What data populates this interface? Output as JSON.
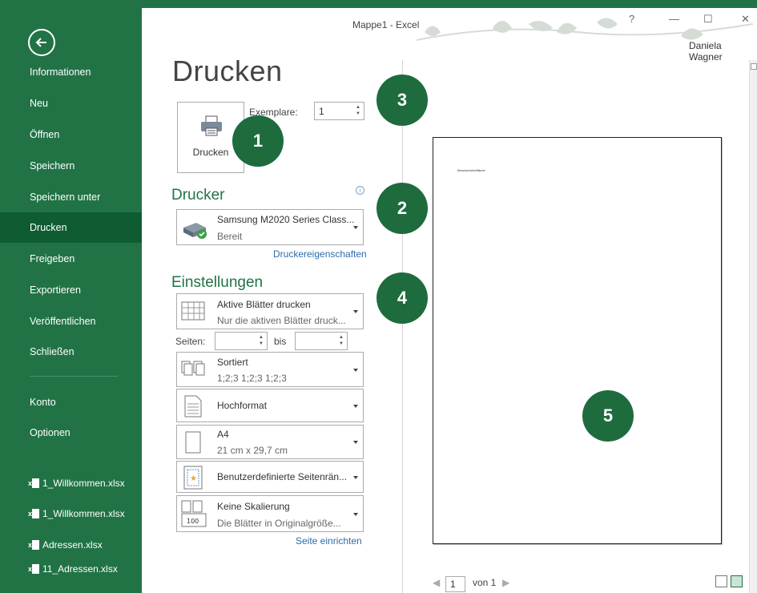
{
  "window": {
    "title": "Mappe1 - Excel",
    "help": "?",
    "minimize": "—",
    "maximize": "☐",
    "close": "✕",
    "user": "Daniela Wagner"
  },
  "sidebar": {
    "back_icon": "back-arrow-icon",
    "items": [
      {
        "label": "Informationen"
      },
      {
        "label": "Neu"
      },
      {
        "label": "Öffnen"
      },
      {
        "label": "Speichern"
      },
      {
        "label": "Speichern unter"
      },
      {
        "label": "Drucken",
        "active": true
      },
      {
        "label": "Freigeben"
      },
      {
        "label": "Exportieren"
      },
      {
        "label": "Veröffentlichen"
      },
      {
        "label": "Schließen"
      },
      {
        "label": "Konto"
      },
      {
        "label": "Optionen"
      }
    ],
    "recent": [
      {
        "label": "1_Willkommen.xlsx"
      },
      {
        "label": "1_Willkommen.xlsx"
      },
      {
        "label": "Adressen.xlsx"
      },
      {
        "label": "11_Adressen.xlsx"
      }
    ]
  },
  "print": {
    "heading": "Drucken",
    "print_button": "Drucken",
    "copies_label": "Exemplare:",
    "copies_value": "1",
    "printer_heading": "Drucker",
    "printer_name": "Samsung M2020 Series Class...",
    "printer_status": "Bereit",
    "printer_properties_link": "Druckereigenschaften",
    "settings_heading": "Einstellungen",
    "what": {
      "title": "Aktive Blätter drucken",
      "sub": "Nur die aktiven Blätter druck..."
    },
    "pages_label": "Seiten:",
    "to_label": "bis",
    "collate": {
      "title": "Sortiert",
      "sub": "1;2;3   1;2;3   1;2;3"
    },
    "orientation": {
      "title": "Hochformat"
    },
    "paper": {
      "title": "A4",
      "sub": "21 cm x 29,7 cm"
    },
    "margins": {
      "title": "Benutzerdefinierte Seitenrän..."
    },
    "scaling": {
      "title": "Keine Skalierung",
      "sub": "Die Blätter in Originalgröße..."
    },
    "page_setup_link": "Seite einrichten"
  },
  "preview": {
    "page_text": "Benutzeroberfläche",
    "current_page": "1",
    "of_label": "von 1",
    "prev": "◀",
    "next": "▶"
  },
  "callouts": [
    "1",
    "2",
    "3",
    "4",
    "5"
  ],
  "colors": {
    "accent": "#217346",
    "callout": "#1e6b3e",
    "link": "#2e6dab"
  }
}
